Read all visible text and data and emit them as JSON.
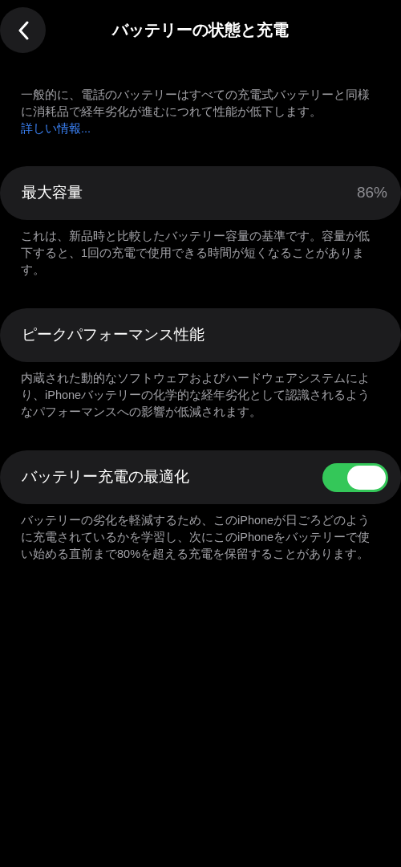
{
  "header": {
    "title": "バッテリーの状態と充電"
  },
  "intro": {
    "text": "一般的に、電話のバッテリーはすべての充電式バッテリーと同様に消耗品で経年劣化が進むにつれて性能が低下します。",
    "link": "詳しい情報..."
  },
  "sections": [
    {
      "kind": "value",
      "label": "最大容量",
      "value": "86%",
      "footnote": "これは、新品時と比較したバッテリー容量の基準です。容量が低下すると、1回の充電で使用できる時間が短くなることがあります。"
    },
    {
      "kind": "plain",
      "label": "ピークパフォーマンス性能",
      "footnote": "内蔵された動的なソフトウェアおよびハードウェアシステムにより、iPhoneバッテリーの化学的な経年劣化として認識されるようなパフォーマンスへの影響が低減されます。"
    },
    {
      "kind": "toggle",
      "label": "バッテリー充電の最適化",
      "on": true,
      "footnote": "バッテリーの劣化を軽減するため、このiPhoneが日ごろどのように充電されているかを学習し、次にこのiPhoneをバッテリーで使い始める直前まで80%を超える充電を保留することがあります。"
    }
  ]
}
